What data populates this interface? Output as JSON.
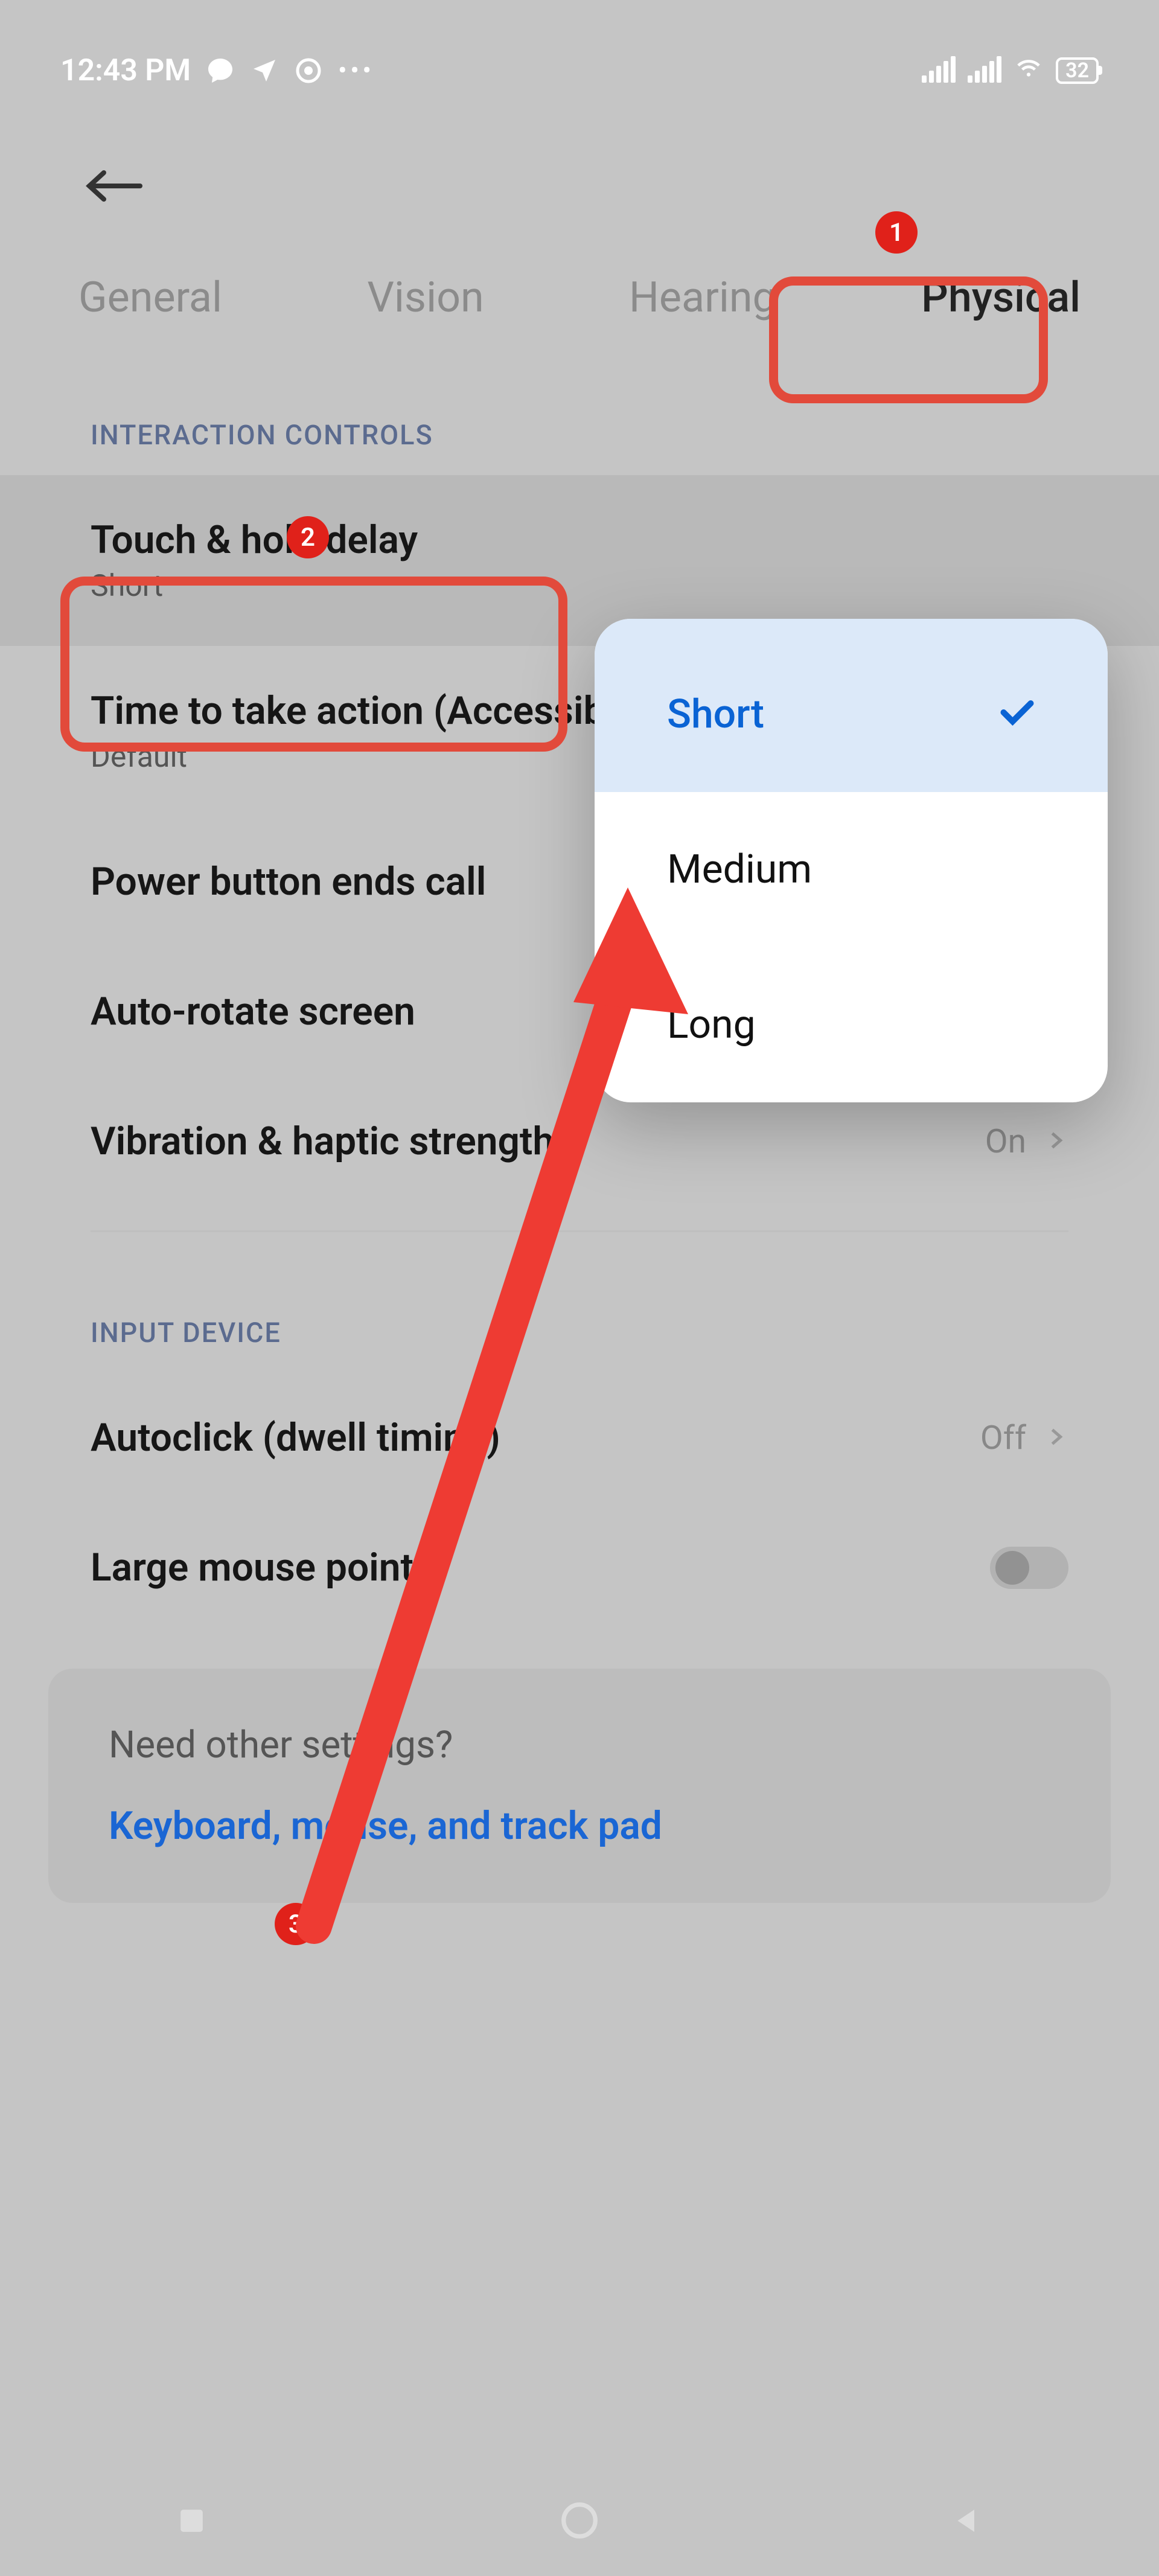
{
  "status": {
    "time": "12:43 PM",
    "battery": "32"
  },
  "tabs": {
    "general": "General",
    "vision": "Vision",
    "hearing": "Hearing",
    "physical": "Physical"
  },
  "sections": {
    "interaction": "INTERACTION CONTROLS",
    "input_device": "INPUT DEVICE"
  },
  "items": {
    "touch_hold": {
      "title": "Touch & hold delay",
      "sub": "Short"
    },
    "time_action": {
      "title": "Time to take action (Accessibility timeout)",
      "sub": "Default"
    },
    "power_button": {
      "title": "Power button ends call"
    },
    "auto_rotate": {
      "title": "Auto-rotate screen"
    },
    "vibration": {
      "title": "Vibration & haptic strength",
      "value": "On"
    },
    "autoclick": {
      "title": "Autoclick (dwell timing)",
      "value": "Off"
    },
    "large_pointer": {
      "title": "Large mouse pointer"
    }
  },
  "popup": {
    "short": "Short",
    "medium": "Medium",
    "long": "Long"
  },
  "hint": {
    "title": "Need other settings?",
    "link": "Keyboard, mouse, and track pad"
  },
  "annotations": {
    "one": "1",
    "two": "2",
    "three": "3"
  }
}
